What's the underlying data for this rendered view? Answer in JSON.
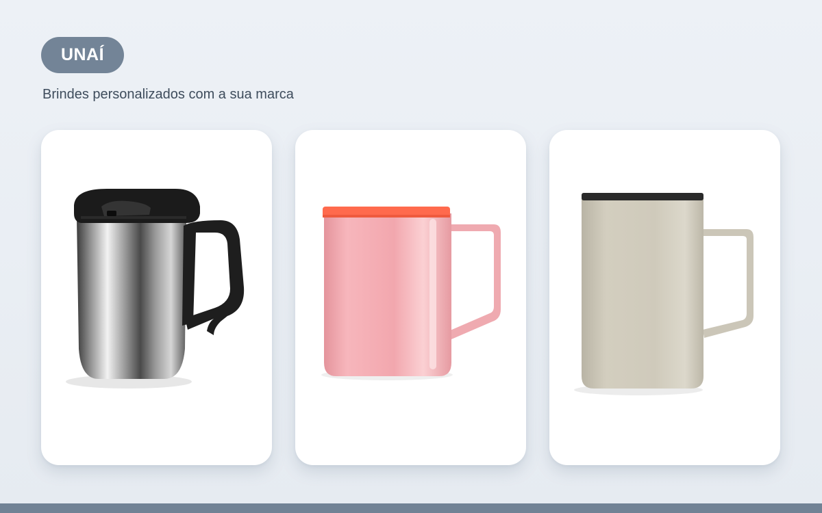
{
  "brand": {
    "name": "UNAÍ"
  },
  "tagline": "Brindes personalizados com a sua marca",
  "products": [
    {
      "image": "stainless-steel-mug-with-black-lid",
      "colors": {
        "body": "#9a9a9a",
        "lid": "#1c1c1c"
      }
    },
    {
      "image": "pink-mug-with-orange-lid",
      "colors": {
        "body": "#f2a7ae",
        "lid": "#ff6a4d"
      }
    },
    {
      "image": "beige-mug-with-black-lid",
      "colors": {
        "body": "#cfcabb",
        "lid": "#2a2a2a"
      }
    }
  ]
}
